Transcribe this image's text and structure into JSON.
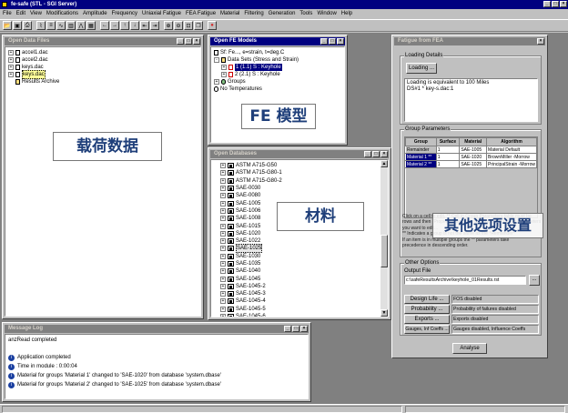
{
  "app": {
    "title": "fe-safe (STL - SGI Server)"
  },
  "menu": [
    "File",
    "Edit",
    "View",
    "Modifications",
    "Amplitude",
    "Frequency",
    "Uniaxial Fatigue",
    "FEA Fatigue",
    "Material",
    "Filtering",
    "Generation",
    "Tools",
    "Window",
    "Help"
  ],
  "colors": {
    "titlebar_active": "#000080",
    "desktop": "#808080",
    "face": "#c0c0c0",
    "stop": "#d42a2a",
    "annot_text": "#1f3f7a"
  },
  "toolbar_icons": [
    "open-icon",
    "save-icon",
    "print-icon",
    "plot-icon",
    "list-icon",
    "cycle-icon",
    "histogram-icon",
    "fft-icon",
    "table-icon",
    "left-arrow-icon",
    "right-arrow-icon",
    "up-arrow-icon",
    "down-arrow-icon",
    "first-icon",
    "last-icon",
    "zoom-in-icon",
    "zoom-out-icon",
    "zoom-fit-icon",
    "window-icon",
    "stop-icon"
  ],
  "open_data_files": {
    "title": "Open Data Files",
    "items": [
      "accel1.dac",
      "accel2.dac",
      "keys.dac",
      "keys.dac",
      "Results Archive"
    ]
  },
  "fe_models": {
    "title": "Open FE Models",
    "items": [
      "Sf: Fe..., e=strain, t=deg.C",
      "Data Sets (Stress and Strain)",
      "1 (1.1) S : Keyhole",
      "2 (2.1) S : Keyhole",
      "Groups",
      "No Temperatures"
    ],
    "annotation": "FE 模型"
  },
  "load_annotation": "载荷数据",
  "open_databases": {
    "title": "Open Databases",
    "items": [
      "ASTM A715-G50",
      "ASTM A715-G80-1",
      "ASTM A715-G80-2",
      "SAE-0030",
      "SAE-0080",
      "SAE-1005",
      "SAE-1006",
      "SAE-1008",
      "SAE-1015",
      "SAE-1020",
      "SAE-1022",
      "SAE-1025",
      "SAE-1030",
      "SAE-1035",
      "SAE-1040",
      "SAE-1045",
      "SAE-1045-2",
      "SAE-1045-3",
      "SAE-1045-4",
      "SAE-1045-5",
      "SAE-1045-6"
    ],
    "annotation": "材料"
  },
  "fatigue": {
    "title": "Fatigue from FEA",
    "loading_details_label": "Loading Details",
    "loading_button": "Loading ...",
    "loading_text": [
      "Loading is equivalent to 100 Miles",
      "DS#1 * key-s.dac:1"
    ],
    "group_params_label": "Group Parameters",
    "headers": [
      "Group",
      "Surface",
      "Material",
      "Algorithm"
    ],
    "rows": [
      [
        "Remainder",
        "1",
        "SAE-1005",
        "Material Default"
      ],
      [
        "Material 1 **",
        "1",
        "SAE-1020",
        "BrownMiller -Morrow"
      ],
      [
        "Material 2 **",
        "1",
        "SAE-1025",
        "PrincipalStrain -Morrow"
      ]
    ],
    "info_text": [
      "Click on a cell to edit. ** Cell in Group Parameters table must be",
      "rows and then (Property change to group(s)). The Group Parameters table",
      "you want to edit...",
      "** Indicates a group is not the same as the *Remainder*",
      "If an item is in multiple groups the ** parameters take",
      "precedence in descending order."
    ],
    "other_options_label": "Other Options",
    "output_label": "Output File",
    "output_value": "c:\\safeResultsArchive\\keyhole_01Results.rst",
    "browse": "...",
    "options": [
      [
        "Design Life ...",
        "FOS disabled"
      ],
      [
        "Probability ...",
        "Probability of failures disabled"
      ],
      [
        "Exports ...",
        "Exports disabled"
      ],
      [
        "Gauges, Inf Coeffs ...",
        "Gauges disabled, Influence Coeffs"
      ]
    ],
    "analyse": "Analyse",
    "annotation": "其他选项设置"
  },
  "message_log": {
    "title": "Message Log",
    "lines": [
      "anzRead completed",
      "Application completed",
      "Time in module : 0:00:04",
      "Material for groups 'Material 1' changed to 'SAE-1020' from database 'system.dbase'",
      "Material for groups 'Material 2' changed to 'SAE-1025' from database 'system.dbase'"
    ]
  }
}
